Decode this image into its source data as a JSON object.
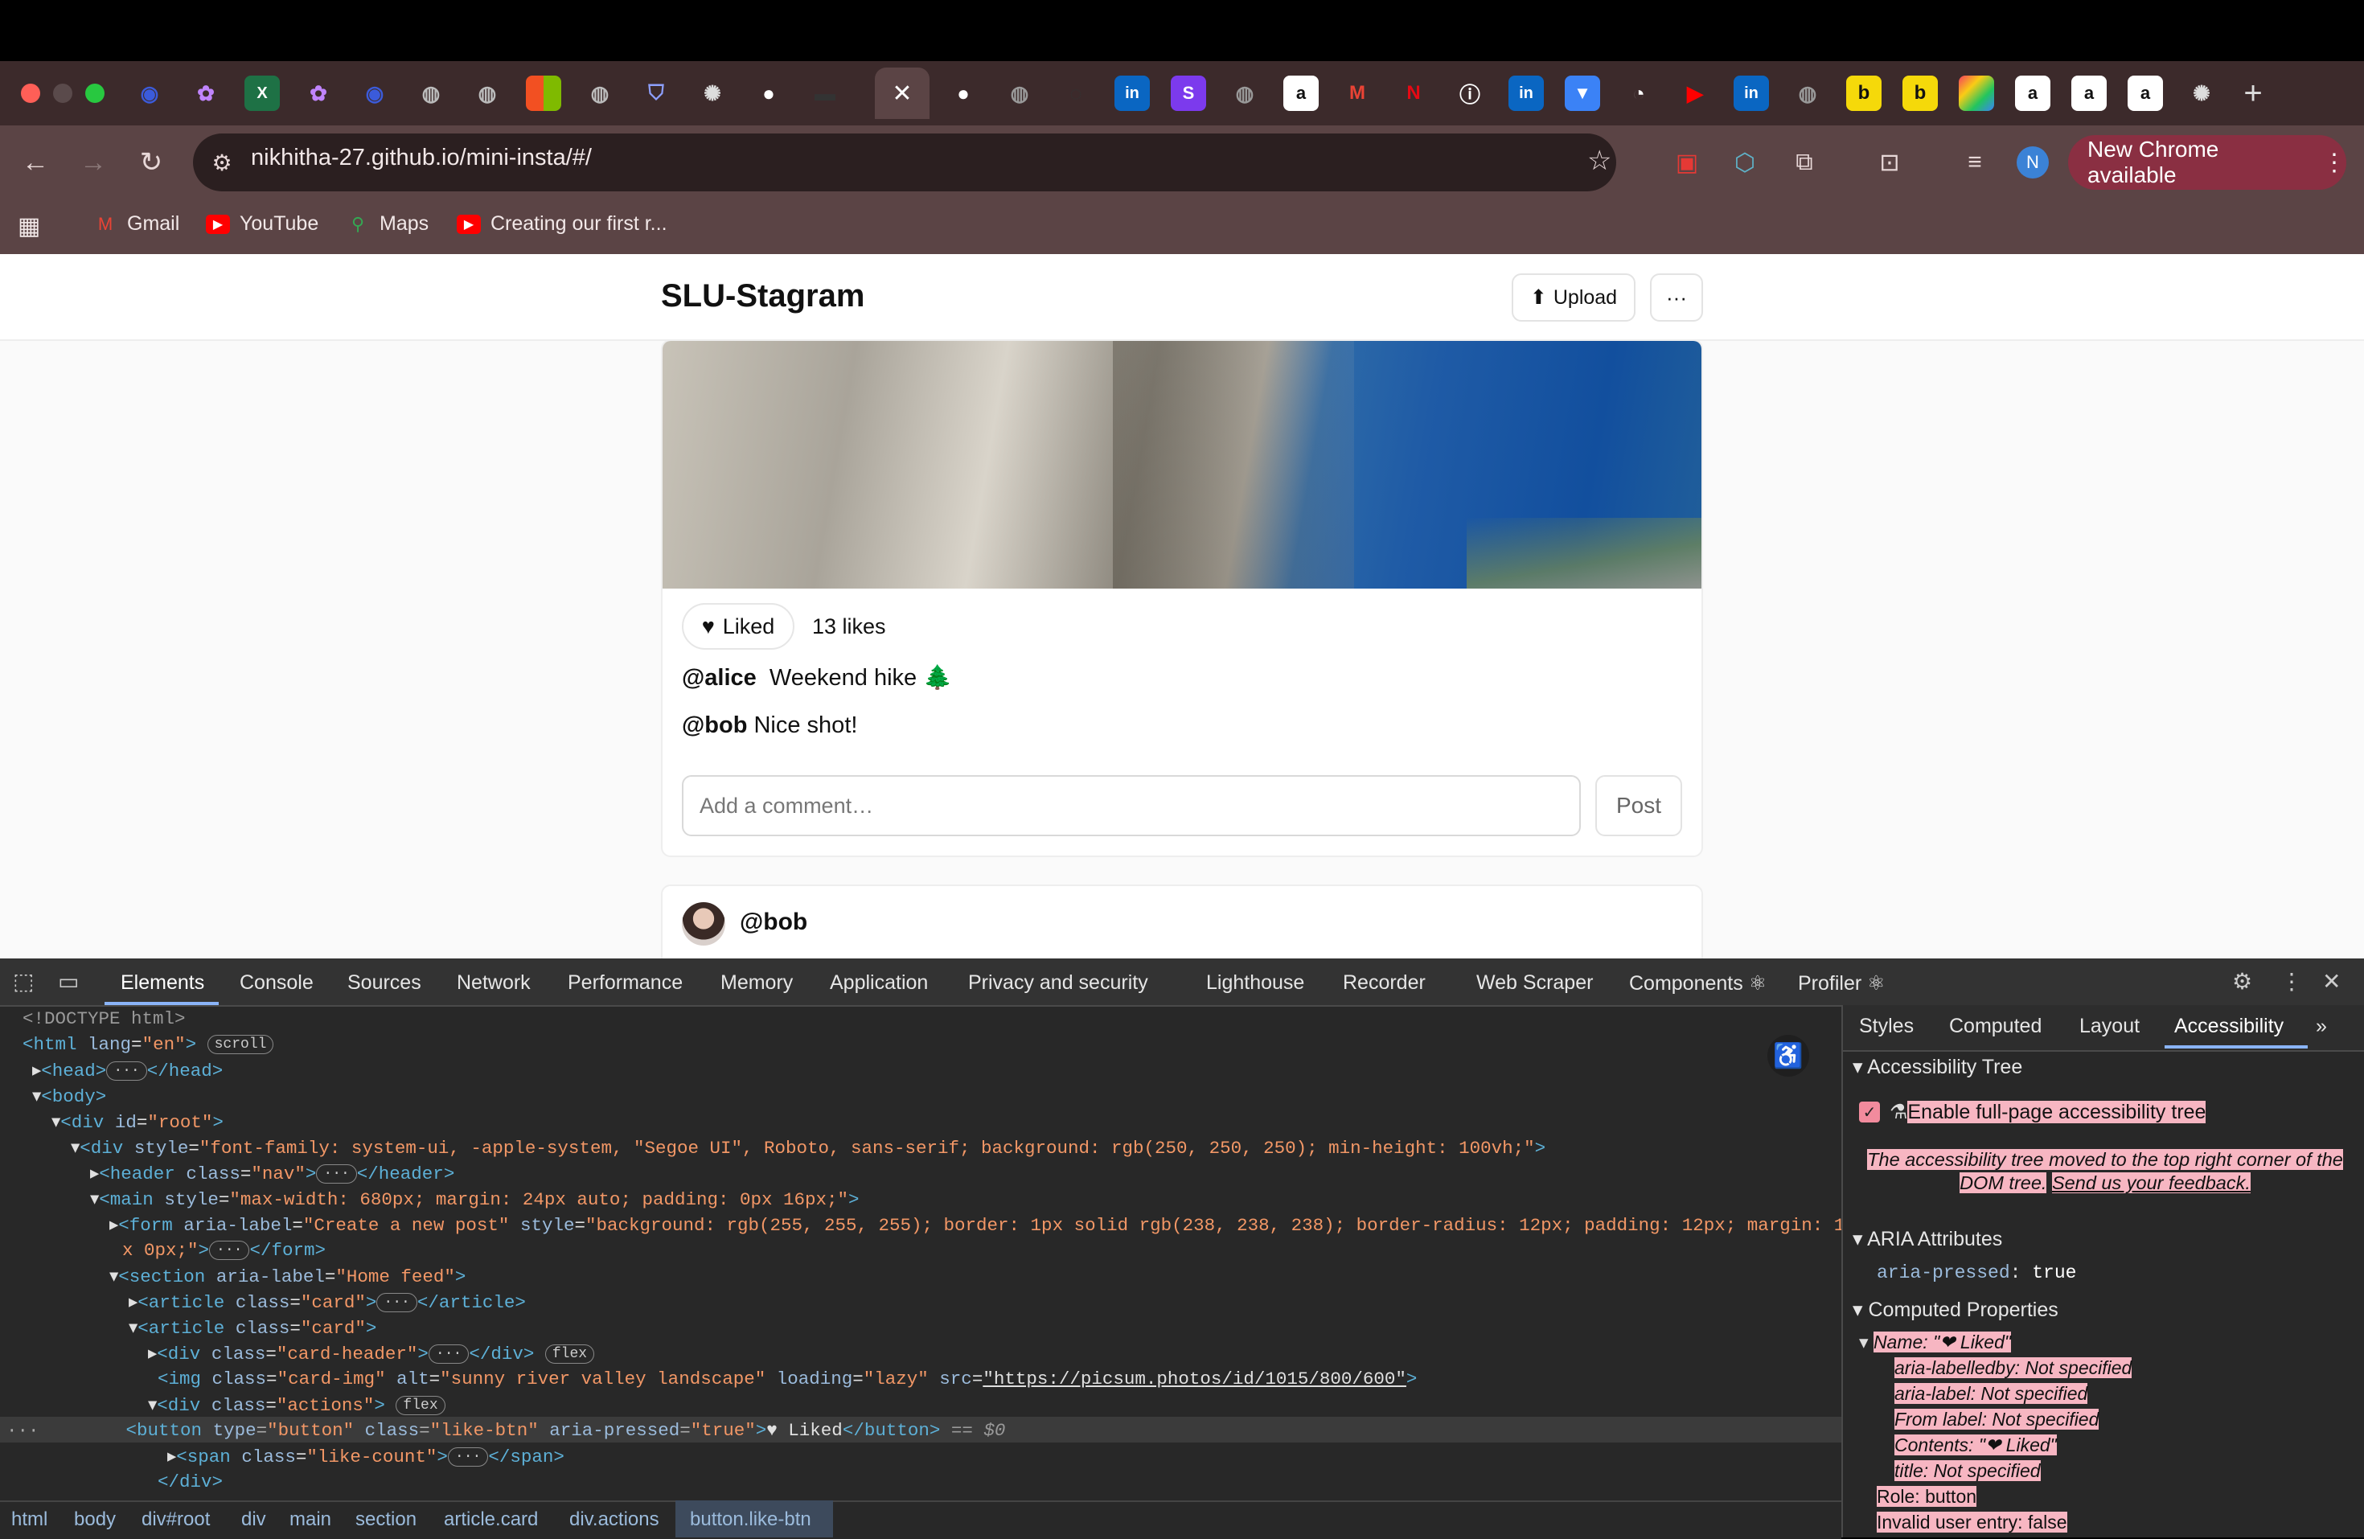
{
  "browser": {
    "new_chrome": "New Chrome available",
    "url": "nikhitha-27.github.io/mini-insta/#/",
    "profile_initial": "N",
    "bookmarks": [
      "Gmail",
      "YouTube",
      "Maps",
      "Creating our first r..."
    ]
  },
  "app": {
    "brand": "SLU-Stagram",
    "upload_label": "Upload",
    "more_label": "···",
    "post": {
      "liked_label": "Liked",
      "likes_count": "13 likes",
      "caption_user": "@alice",
      "caption_text": "Weekend hike 🌲",
      "comment_user": "@bob",
      "comment_text": "Nice shot!",
      "comment_placeholder": "Add a comment…",
      "post_button": "Post"
    },
    "next_post_user": "@bob"
  },
  "devtools": {
    "tabs": [
      "Elements",
      "Console",
      "Sources",
      "Network",
      "Performance",
      "Memory",
      "Application",
      "Privacy and security",
      "Lighthouse",
      "Recorder",
      "Web Scraper",
      "Components ⚛",
      "Profiler ⚛"
    ],
    "breadcrumbs": [
      "html",
      "body",
      "div#root",
      "div",
      "main",
      "section",
      "article.card",
      "div.actions",
      "button.like-btn"
    ],
    "side_tabs": [
      "Styles",
      "Computed",
      "Layout",
      "Accessibility"
    ],
    "accessibility": {
      "tree_heading": "Accessibility Tree",
      "enable_label": "Enable full-page accessibility tree",
      "moved_note": "The accessibility tree moved to the top right corner of the DOM tree.",
      "feedback_link": "Send us your feedback.",
      "aria_heading": "ARIA Attributes",
      "aria_pressed_key": "aria-pressed",
      "aria_pressed_val": "true",
      "computed_heading": "Computed Properties",
      "name_line": "Name: \"❤ Liked\"",
      "labelledby": "aria-labelledby: Not specified",
      "label": "aria-label: Not specified",
      "from_label": "From label: Not specified",
      "contents": "Contents: \"❤ Liked\"",
      "title": "title: Not specified",
      "role": "Role: button",
      "invalid": "Invalid user entry: false"
    }
  }
}
